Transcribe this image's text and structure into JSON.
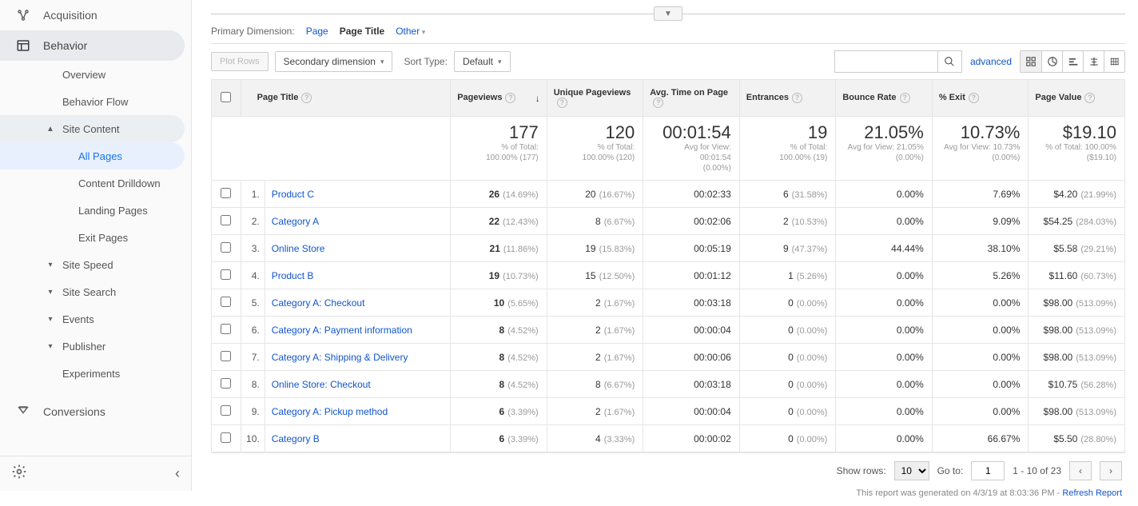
{
  "sidebar": {
    "acquisition": "Acquisition",
    "behavior": "Behavior",
    "behavior_children": {
      "overview": "Overview",
      "flow": "Behavior Flow",
      "site_content": "Site Content",
      "site_content_children": {
        "all_pages": "All Pages",
        "content_drilldown": "Content Drilldown",
        "landing_pages": "Landing Pages",
        "exit_pages": "Exit Pages"
      },
      "site_speed": "Site Speed",
      "site_search": "Site Search",
      "events": "Events",
      "publisher": "Publisher",
      "experiments": "Experiments"
    },
    "conversions": "Conversions"
  },
  "dimbar": {
    "label": "Primary Dimension:",
    "page": "Page",
    "page_title": "Page Title",
    "other": "Other"
  },
  "toolbar": {
    "plot_rows": "Plot Rows",
    "secondary_dimension": "Secondary dimension",
    "sort_type_label": "Sort Type:",
    "sort_type_value": "Default",
    "advanced": "advanced",
    "search_placeholder": ""
  },
  "columns": {
    "page_title": "Page Title",
    "pageviews": "Pageviews",
    "unique_pageviews": "Unique Pageviews",
    "avg_time": "Avg. Time on Page",
    "entrances": "Entrances",
    "bounce_rate": "Bounce Rate",
    "pct_exit": "% Exit",
    "page_value": "Page Value"
  },
  "summary": {
    "pageviews": {
      "big": "177",
      "sub1": "% of Total:",
      "sub2": "100.00% (177)"
    },
    "unique": {
      "big": "120",
      "sub1": "% of Total:",
      "sub2": "100.00% (120)"
    },
    "avg_time": {
      "big": "00:01:54",
      "sub1": "Avg for View: 00:01:54",
      "sub2": "(0.00%)"
    },
    "entrances": {
      "big": "19",
      "sub1": "% of Total:",
      "sub2": "100.00% (19)"
    },
    "bounce": {
      "big": "21.05%",
      "sub1": "Avg for View: 21.05%",
      "sub2": "(0.00%)"
    },
    "exit": {
      "big": "10.73%",
      "sub1": "Avg for View: 10.73%",
      "sub2": "(0.00%)"
    },
    "value": {
      "big": "$19.10",
      "sub1": "% of Total: 100.00%",
      "sub2": "($19.10)"
    }
  },
  "rows": [
    {
      "idx": "1.",
      "title": "Product C",
      "pv": "26",
      "pv_pct": "(14.69%)",
      "upv": "20",
      "upv_pct": "(16.67%)",
      "time": "00:02:33",
      "ent": "6",
      "ent_pct": "(31.58%)",
      "bounce": "0.00%",
      "exit": "7.69%",
      "val": "$4.20",
      "val_pct": "(21.99%)"
    },
    {
      "idx": "2.",
      "title": "Category A",
      "pv": "22",
      "pv_pct": "(12.43%)",
      "upv": "8",
      "upv_pct": "(6.67%)",
      "time": "00:02:06",
      "ent": "2",
      "ent_pct": "(10.53%)",
      "bounce": "0.00%",
      "exit": "9.09%",
      "val": "$54.25",
      "val_pct": "(284.03%)"
    },
    {
      "idx": "3.",
      "title": "Online Store",
      "pv": "21",
      "pv_pct": "(11.86%)",
      "upv": "19",
      "upv_pct": "(15.83%)",
      "time": "00:05:19",
      "ent": "9",
      "ent_pct": "(47.37%)",
      "bounce": "44.44%",
      "exit": "38.10%",
      "val": "$5.58",
      "val_pct": "(29.21%)"
    },
    {
      "idx": "4.",
      "title": "Product B",
      "pv": "19",
      "pv_pct": "(10.73%)",
      "upv": "15",
      "upv_pct": "(12.50%)",
      "time": "00:01:12",
      "ent": "1",
      "ent_pct": "(5.26%)",
      "bounce": "0.00%",
      "exit": "5.26%",
      "val": "$11.60",
      "val_pct": "(60.73%)"
    },
    {
      "idx": "5.",
      "title": "Category A: Checkout",
      "pv": "10",
      "pv_pct": "(5.65%)",
      "upv": "2",
      "upv_pct": "(1.67%)",
      "time": "00:03:18",
      "ent": "0",
      "ent_pct": "(0.00%)",
      "bounce": "0.00%",
      "exit": "0.00%",
      "val": "$98.00",
      "val_pct": "(513.09%)"
    },
    {
      "idx": "6.",
      "title": "Category A: Payment information",
      "pv": "8",
      "pv_pct": "(4.52%)",
      "upv": "2",
      "upv_pct": "(1.67%)",
      "time": "00:00:04",
      "ent": "0",
      "ent_pct": "(0.00%)",
      "bounce": "0.00%",
      "exit": "0.00%",
      "val": "$98.00",
      "val_pct": "(513.09%)"
    },
    {
      "idx": "7.",
      "title": "Category A: Shipping & Delivery",
      "pv": "8",
      "pv_pct": "(4.52%)",
      "upv": "2",
      "upv_pct": "(1.67%)",
      "time": "00:00:06",
      "ent": "0",
      "ent_pct": "(0.00%)",
      "bounce": "0.00%",
      "exit": "0.00%",
      "val": "$98.00",
      "val_pct": "(513.09%)"
    },
    {
      "idx": "8.",
      "title": "Online Store: Checkout",
      "pv": "8",
      "pv_pct": "(4.52%)",
      "upv": "8",
      "upv_pct": "(6.67%)",
      "time": "00:03:18",
      "ent": "0",
      "ent_pct": "(0.00%)",
      "bounce": "0.00%",
      "exit": "0.00%",
      "val": "$10.75",
      "val_pct": "(56.28%)"
    },
    {
      "idx": "9.",
      "title": "Category A: Pickup method",
      "pv": "6",
      "pv_pct": "(3.39%)",
      "upv": "2",
      "upv_pct": "(1.67%)",
      "time": "00:00:04",
      "ent": "0",
      "ent_pct": "(0.00%)",
      "bounce": "0.00%",
      "exit": "0.00%",
      "val": "$98.00",
      "val_pct": "(513.09%)"
    },
    {
      "idx": "10.",
      "title": "Category B",
      "pv": "6",
      "pv_pct": "(3.39%)",
      "upv": "4",
      "upv_pct": "(3.33%)",
      "time": "00:00:02",
      "ent": "0",
      "ent_pct": "(0.00%)",
      "bounce": "0.00%",
      "exit": "66.67%",
      "val": "$5.50",
      "val_pct": "(28.80%)"
    }
  ],
  "footer": {
    "show_rows_label": "Show rows:",
    "show_rows_value": "10",
    "goto_label": "Go to:",
    "goto_value": "1",
    "range": "1 - 10 of 23",
    "generated_prefix": "This report was generated on 4/3/19 at 8:03:36 PM - ",
    "refresh": "Refresh Report"
  }
}
